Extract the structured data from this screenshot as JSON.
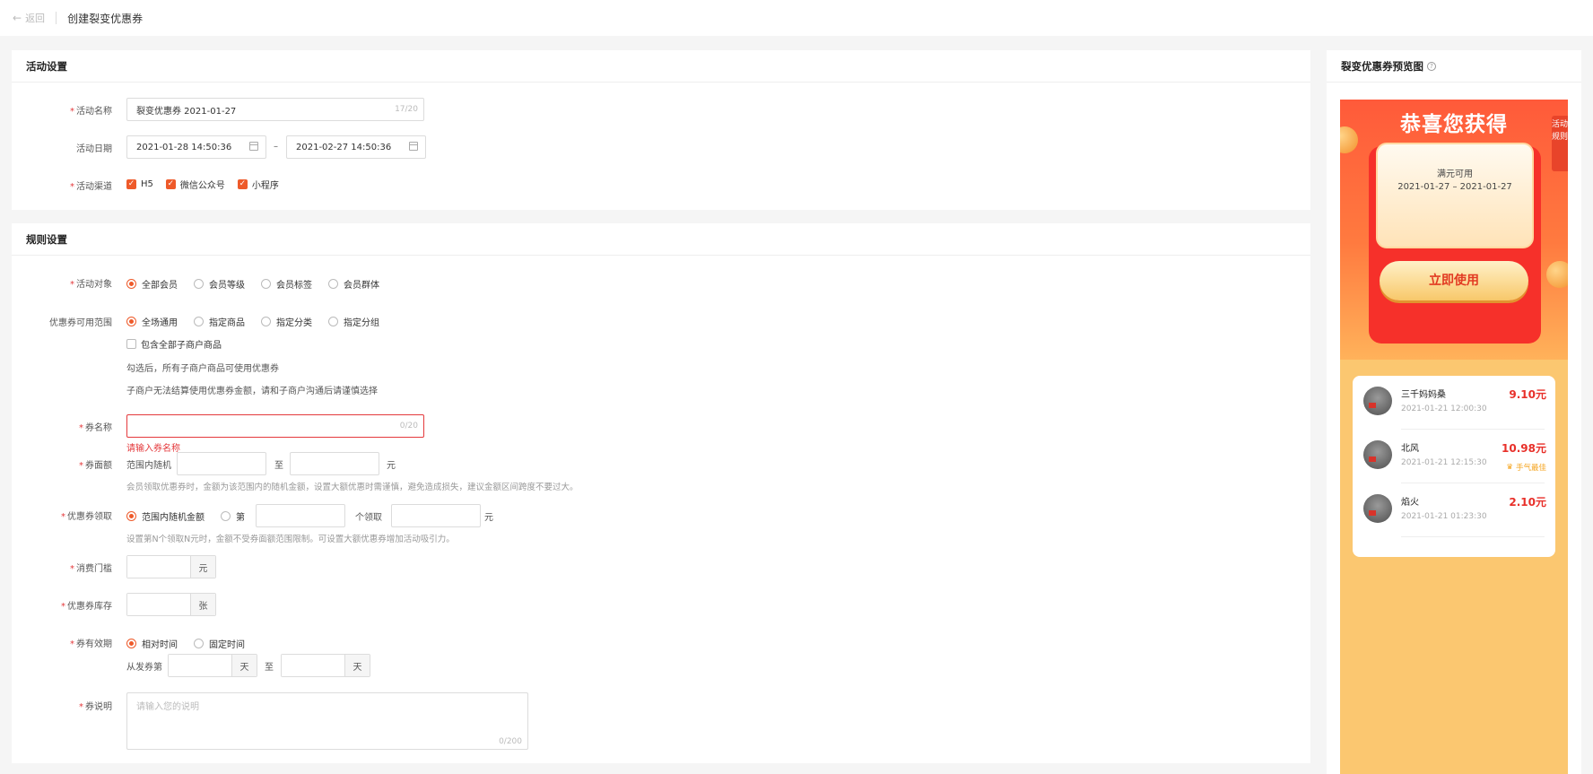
{
  "header": {
    "back_label": "返回",
    "title": "创建裂变优惠券"
  },
  "activity": {
    "title": "活动设置",
    "name_label": "活动名称",
    "name_value": "裂变优惠券  2021-01-27",
    "name_count": "17/20",
    "date_label": "活动日期",
    "date_start": "2021-01-28 14:50:36",
    "date_sep": "–",
    "date_end": "2021-02-27 14:50:36",
    "channel_label": "活动渠道",
    "channels": [
      "H5",
      "微信公众号",
      "小程序"
    ]
  },
  "rules": {
    "title": "规则设置",
    "target_label": "活动对象",
    "target_options": [
      "全部会员",
      "会员等级",
      "会员标签",
      "会员群体"
    ],
    "scope_label": "优惠券可用范围",
    "scope_options": [
      "全场通用",
      "指定商品",
      "指定分类",
      "指定分组"
    ],
    "include_sub": "包含全部子商户商品",
    "scope_note1": "勾选后，所有子商户商品可使用优惠券",
    "scope_note2": "子商户无法结算使用优惠券金额，请和子商户沟通后请谨慎选择",
    "coupon_name_label": "券名称",
    "coupon_name_count": "0/20",
    "coupon_name_error": "请输入券名称",
    "face_label": "券面额",
    "face_prefix": "范围内随机",
    "face_to": "至",
    "face_unit": "元",
    "face_hint": "会员领取优惠券时，金额为该范围内的随机金额，设置大额优惠时需谨慎，避免造成损失，建议金额区间跨度不要过大。",
    "receive_label": "优惠券领取",
    "receive_opt1": "范围内随机金额",
    "receive_opt2": "第",
    "receive_mid": "个领取",
    "receive_unit": "元",
    "receive_hint": "设置第N个领取N元时，金额不受券面额范围限制。可设置大额优惠券增加活动吸引力。",
    "threshold_label": "消费门槛",
    "threshold_unit": "元",
    "stock_label": "优惠券库存",
    "stock_unit": "张",
    "valid_label": "券有效期",
    "valid_opt1": "相对时间",
    "valid_opt2": "固定时间",
    "valid_from": "从发券第",
    "valid_day": "天",
    "valid_to": "至",
    "desc_label": "券说明",
    "desc_placeholder": "请输入您的说明",
    "desc_count": "0/200"
  },
  "preview": {
    "title": "裂变优惠券预览图",
    "help_icon": "question-circle-icon",
    "congrats": "恭喜您获得",
    "rules_tab": "活动规则",
    "card_line1": "满元可用",
    "card_line2": "2021-01-27 – 2021-01-27",
    "use_button": "立即使用",
    "records": [
      {
        "name": "三千妈妈桑",
        "time": "2021-01-21 12:00:30",
        "amount": "9.10元",
        "best": ""
      },
      {
        "name": "北风",
        "time": "2021-01-21 12:15:30",
        "amount": "10.98元",
        "best": "手气最佳"
      },
      {
        "name": "焰火",
        "time": "2021-01-21 01:23:30",
        "amount": "2.10元",
        "best": ""
      }
    ]
  },
  "colors": {
    "accent": "#ee5a2a",
    "error": "#e4393c",
    "amount": "#e8302a"
  }
}
